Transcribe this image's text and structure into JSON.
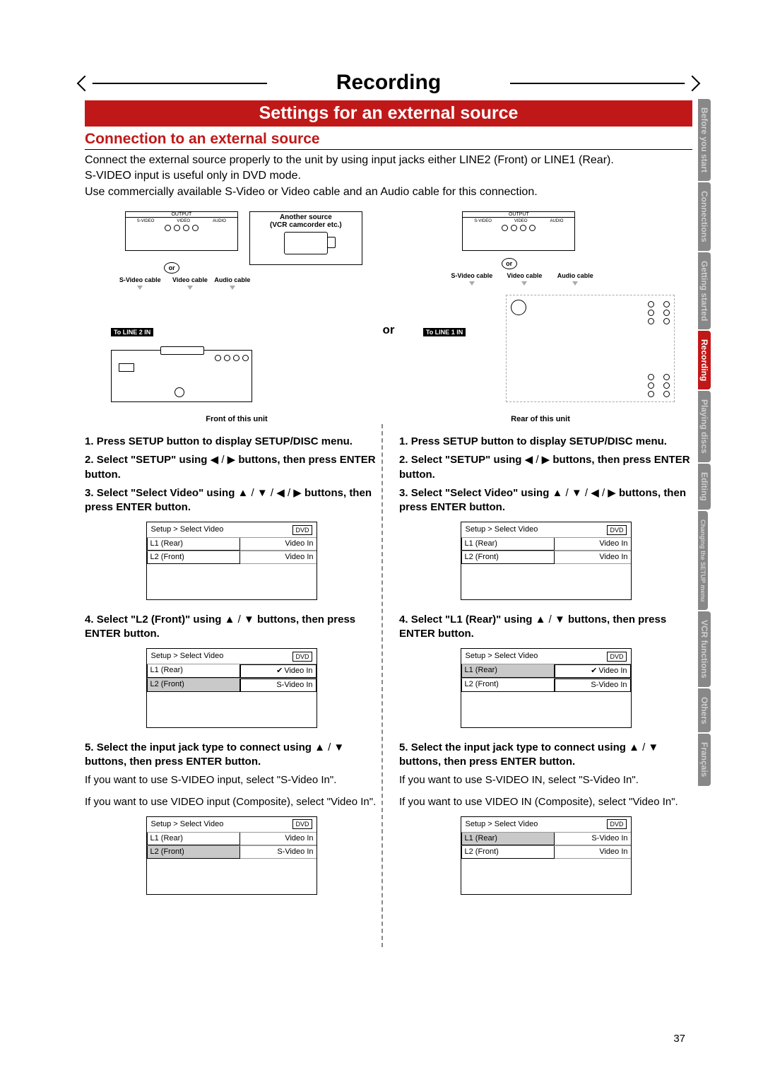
{
  "chapter_title": "Recording",
  "subtitle": "Settings for an external source",
  "section_heading": "Connection to an external source",
  "intro_line1": "Connect the external source properly to the unit by using input jacks either LINE2 (Front) or LINE1 (Rear).",
  "intro_line2": "S-VIDEO input is useful only in DVD mode.",
  "intro_line3": "Use commercially available S-Video or Video cable and an Audio cable for this connection.",
  "diagram": {
    "output_label": "OUTPUT",
    "jack_svideo": "S-VIDEO",
    "jack_video": "VIDEO",
    "jack_audio": "AUDIO",
    "or": "or",
    "another_source_line1": "Another source",
    "another_source_line2": "(VCR camcorder etc.)",
    "svideo_cable": "S-Video cable",
    "video_cable": "Video cable",
    "audio_cable": "Audio cable",
    "to_line2": "To LINE 2 IN",
    "to_line1": "To LINE 1 IN",
    "front_caption": "Front of this unit",
    "rear_caption": "Rear of this unit",
    "center_or": "or"
  },
  "left": {
    "step1": "Press SETUP button to display SETUP/DISC menu.",
    "step2_a": "Select \"SETUP\" using ",
    "step2_b": " buttons, then press ENTER button.",
    "step3_a": "Select \"Select Video\" using ",
    "step3_b": " buttons, then press ENTER button.",
    "step4_a": "Select \"L2 (Front)\" using ",
    "step4_b": " buttons, then press ENTER button.",
    "step5_a": "Select the input jack type to connect using ",
    "step5_b": " buttons, then press ENTER button.",
    "note1": "If you want to use S-VIDEO input, select \"S-Video In\".",
    "note2": "If you want to use VIDEO input (Composite), select \"Video In\"."
  },
  "right": {
    "step1": "Press SETUP button to display SETUP/DISC menu.",
    "step2_a": "Select \"SETUP\" using ",
    "step2_b": " buttons, then press ENTER button.",
    "step3_a": "Select \"Select Video\" using ",
    "step3_b": " buttons, then press ENTER button.",
    "step4_a": "Select \"L1 (Rear)\" using ",
    "step4_b": " buttons, then press ENTER button.",
    "step5_a": "Select the input jack type to connect using ",
    "step5_b": " buttons, then press ENTER button.",
    "note1": "If you want to use S-VIDEO IN, select \"S-Video In\".",
    "note2": "If you want to use VIDEO IN (Composite), select \"Video In\"."
  },
  "menu": {
    "title": "Setup > Select Video",
    "dvd": "DVD",
    "l1": "L1 (Rear)",
    "l2": "L2 (Front)",
    "video_in": "Video In",
    "svideo_in": "S-Video In"
  },
  "arrows": {
    "lr": "◀ / ▶",
    "udlr": "▲ / ▼ / ◀ / ▶",
    "ud": "▲ / ▼"
  },
  "tabs": {
    "t1": "Before you start",
    "t2": "Connections",
    "t3": "Getting started",
    "t4": "Recording",
    "t5": "Playing discs",
    "t6": "Editing",
    "t7": "Changing the SETUP menu",
    "t8": "VCR functions",
    "t9": "Others",
    "t10": "Français"
  },
  "page_number": "37"
}
